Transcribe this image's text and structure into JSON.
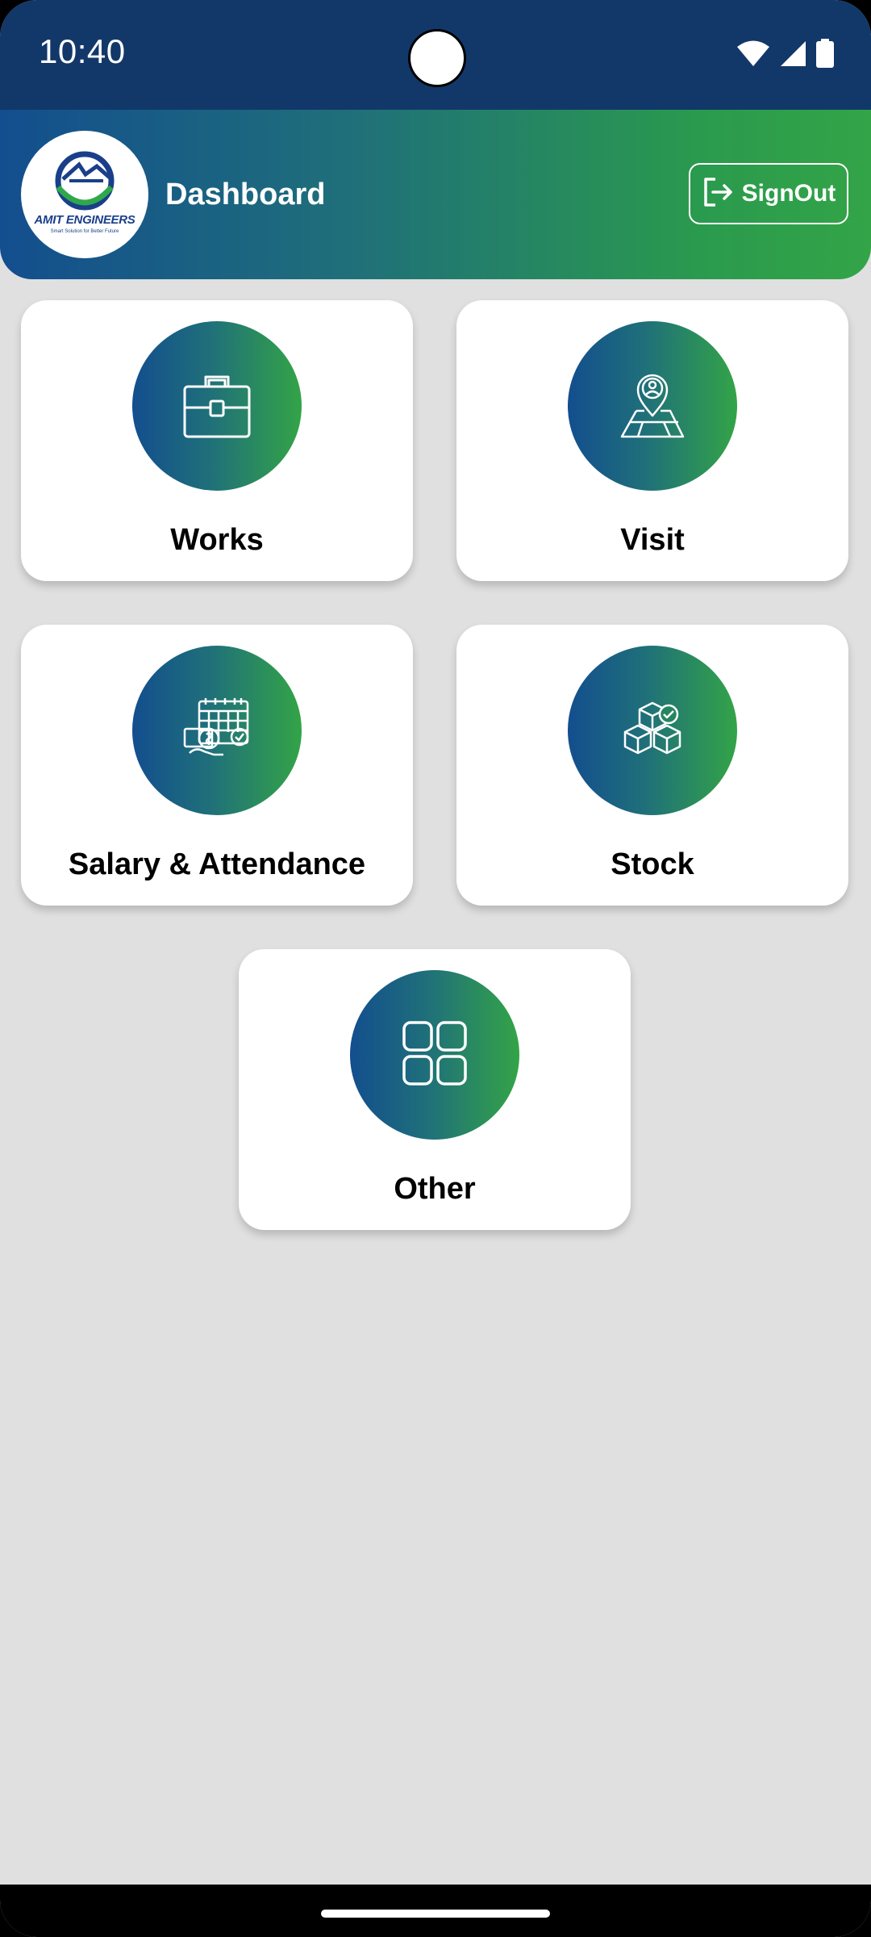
{
  "status_bar": {
    "time": "10:40",
    "icons": [
      "wifi-icon",
      "cellular-signal-icon",
      "battery-icon"
    ]
  },
  "app_bar": {
    "title": "Dashboard",
    "logo": {
      "name": "AMIT ENGINEERS",
      "tagline": "Smart Solution for Better Future"
    },
    "signout_label": "SignOut",
    "signout_icon": "logout-icon"
  },
  "menu": [
    {
      "label": "Works",
      "icon": "briefcase-icon"
    },
    {
      "label": "Visit",
      "icon": "location-map-icon"
    },
    {
      "label": "Salary & Attendance",
      "icon": "payroll-calendar-icon"
    },
    {
      "label": "Stock",
      "icon": "boxes-stock-icon"
    },
    {
      "label": "Other",
      "icon": "grid-icon"
    }
  ],
  "colors": {
    "status_bar_bg": "#12386a",
    "gradient_start": "#134e8e",
    "gradient_end": "#33a447",
    "page_bg": "#e0e0e0",
    "card_bg": "#ffffff"
  }
}
